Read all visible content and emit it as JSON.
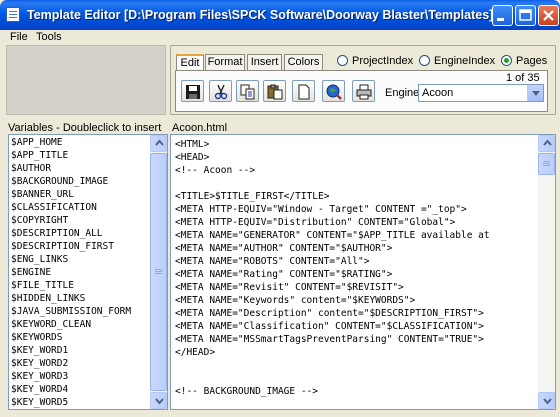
{
  "window": {
    "title": "Template Editor [D:\\Program Files\\SPCK Software\\Doorway Blaster\\Templates]",
    "minimize_icon": "minimize-icon",
    "maximize_icon": "maximize-icon",
    "close_icon": "close-icon"
  },
  "menu": [
    "File",
    "Tools"
  ],
  "tabs": [
    {
      "label": "Edit",
      "active": true
    },
    {
      "label": "Format",
      "active": false
    },
    {
      "label": "Insert",
      "active": false
    },
    {
      "label": "Colors",
      "active": false
    }
  ],
  "radios": [
    {
      "label": "ProjectIndex",
      "selected": false
    },
    {
      "label": "EngineIndex",
      "selected": false
    },
    {
      "label": "Pages",
      "selected": true
    }
  ],
  "toolbar": [
    {
      "icon": "save-icon"
    },
    {
      "icon": "cut-icon"
    },
    {
      "icon": "copy-icon"
    },
    {
      "icon": "paste-icon"
    },
    {
      "icon": "new-page-icon"
    },
    {
      "icon": "preview-globe-icon"
    },
    {
      "icon": "print-icon"
    }
  ],
  "page_count": "1 of 35",
  "engine": {
    "label": "Engine",
    "value": "Acoon"
  },
  "variables_label": "Variables - Doubleclick to insert",
  "variables": [
    "$APP_HOME",
    "$APP_TITLE",
    "$AUTHOR",
    "$BACKGROUND_IMAGE",
    "$BANNER_URL",
    "$CLASSIFICATION",
    "$COPYRIGHT",
    "$DESCRIPTION_ALL",
    "$DESCRIPTION_FIRST",
    "$ENG_LINKS",
    "$ENGINE",
    "$FILE_TITLE",
    "$HIDDEN_LINKS",
    "$JAVA_SUBMISSION_FORM",
    "$KEYWORD_CLEAN",
    "$KEYWORDS",
    "$KEY_WORD1",
    "$KEY_WORD2",
    "$KEY_WORD3",
    "$KEY_WORD4",
    "$KEY_WORD5"
  ],
  "file_name": "Acoon.html",
  "code_lines": [
    "<HTML>",
    "<HEAD>",
    "<!-- Acoon -->",
    "",
    "<TITLE>$TITLE_FIRST</TITLE>",
    "<META HTTP-EQUIV=\"Window - Target\" CONTENT =\"_top\">",
    "<META HTTP-EQUIV=\"Distribution\" CONTENT=\"Global\">",
    "<META NAME=\"GENERATOR\" CONTENT=\"$APP_TITLE available at",
    "<META NAME=\"AUTHOR\" CONTENT=\"$AUTHOR\">",
    "<META NAME=\"ROBOTS\" CONTENT=\"All\">",
    "<META NAME=\"Rating\" CONTENT=\"$RATING\">",
    "<META NAME=\"Revisit\" CONTENT=\"$REVISIT\">",
    "<META NAME=\"Keywords\" content=\"$KEYWORDS\">",
    "<META NAME=\"Description\" content=\"$DESCRIPTION_FIRST\">",
    "<META NAME=\"Classification\" CONTENT=\"$CLASSIFICATION\">",
    "<META NAME=\"MSSmartTagsPreventParsing\" CONTENT=\"TRUE\">",
    "</HEAD>",
    "",
    "",
    "<!-- BACKGROUND_IMAGE -->"
  ]
}
